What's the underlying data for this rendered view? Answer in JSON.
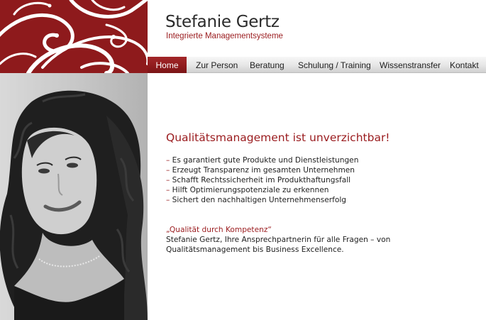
{
  "header": {
    "name": "Stefanie Gertz",
    "subtitle": "Integrierte Managementsysteme"
  },
  "nav": {
    "items": [
      {
        "label": "Home",
        "active": true
      },
      {
        "label": "Zur Person",
        "active": false
      },
      {
        "label": "Beratung",
        "active": false
      },
      {
        "label": "Schulung / Training",
        "active": false
      },
      {
        "label": "Wissenstransfer",
        "active": false
      },
      {
        "label": "Kontakt",
        "active": false
      }
    ]
  },
  "main": {
    "headline": "Qualitätsmanagement ist unverzichtbar!",
    "bullet_marker": "–",
    "bullets": [
      "Es garantiert gute Produkte und Dienstleistungen",
      "Erzeugt Transparenz im gesamten Unternehmen",
      "Schafft Rechtssicherheit im Produkthaftungsfall",
      "Hilft Optimierungspotenziale zu erkennen",
      "Sichert den nachhaltigen Unternehmenserfolg"
    ],
    "quote_title": "„Qualität durch Kompetenz“",
    "quote_body_line1": "Stefanie Gertz, Ihre Ansprechpartnerin für alle Fragen – von",
    "quote_body_line2": "Qualitätsmanagement bis Business Excellence."
  },
  "colors": {
    "brand_red": "#8e1a1c",
    "accent_text_red": "#9a1b1e",
    "nav_gradient_top": "#f7f7f7",
    "nav_gradient_bottom": "#d0d0d0"
  },
  "icons": {
    "ornament": "swirl-ornament-icon",
    "portrait": "portrait-photo"
  }
}
